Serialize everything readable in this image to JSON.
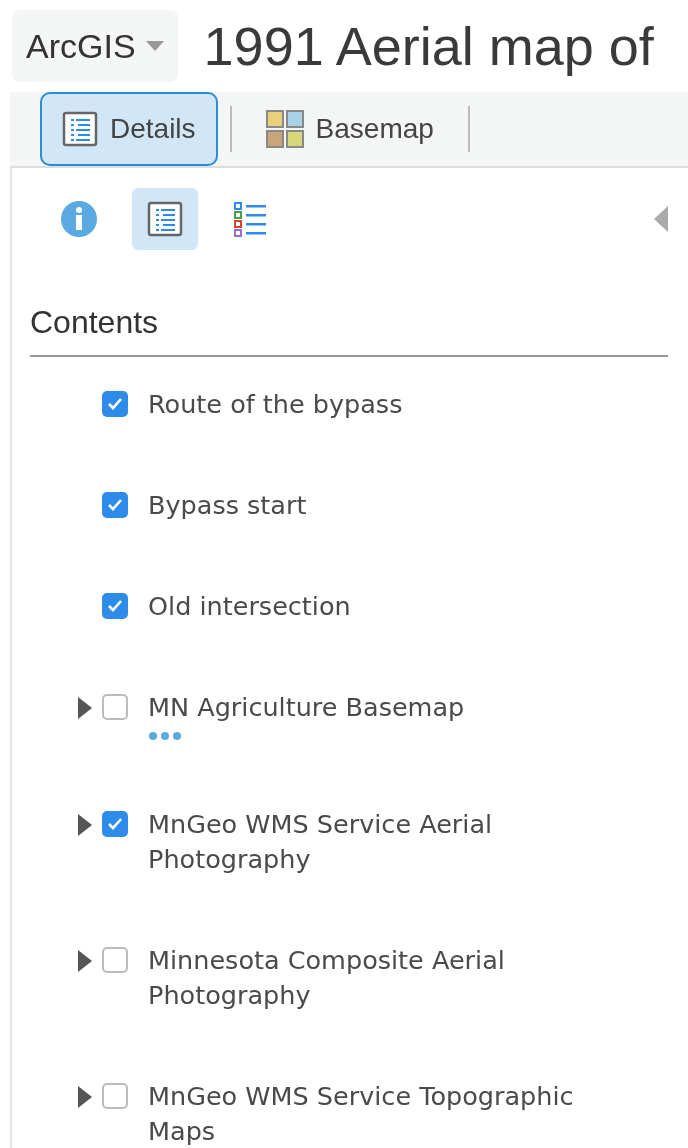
{
  "header": {
    "app_switcher": "ArcGIS",
    "title": "1991 Aerial map of"
  },
  "toolbar": [
    {
      "label": "Details",
      "selected": true
    },
    {
      "label": "Basemap",
      "selected": false
    }
  ],
  "panel_tabs": [
    {
      "selected": false
    },
    {
      "selected": true
    },
    {
      "selected": false
    }
  ],
  "contents": {
    "heading": "Contents",
    "layers": [
      {
        "kind": "layer",
        "label": "Route of the bypass",
        "checked": true
      },
      {
        "kind": "layer",
        "label": "Bypass start",
        "checked": true
      },
      {
        "kind": "layer",
        "label": "Old intersection",
        "checked": true
      },
      {
        "kind": "group",
        "label": "MN Agriculture Basemap",
        "checked": false,
        "expanded": false,
        "more": true
      },
      {
        "kind": "group",
        "label": "MnGeo WMS Service Aerial Photography",
        "checked": true,
        "expanded": false
      },
      {
        "kind": "group",
        "label": "Minnesota Composite Aerial Photography",
        "checked": false,
        "expanded": false
      },
      {
        "kind": "group",
        "label": "MnGeo WMS Service Topographic Maps",
        "checked": false,
        "expanded": false
      }
    ]
  }
}
